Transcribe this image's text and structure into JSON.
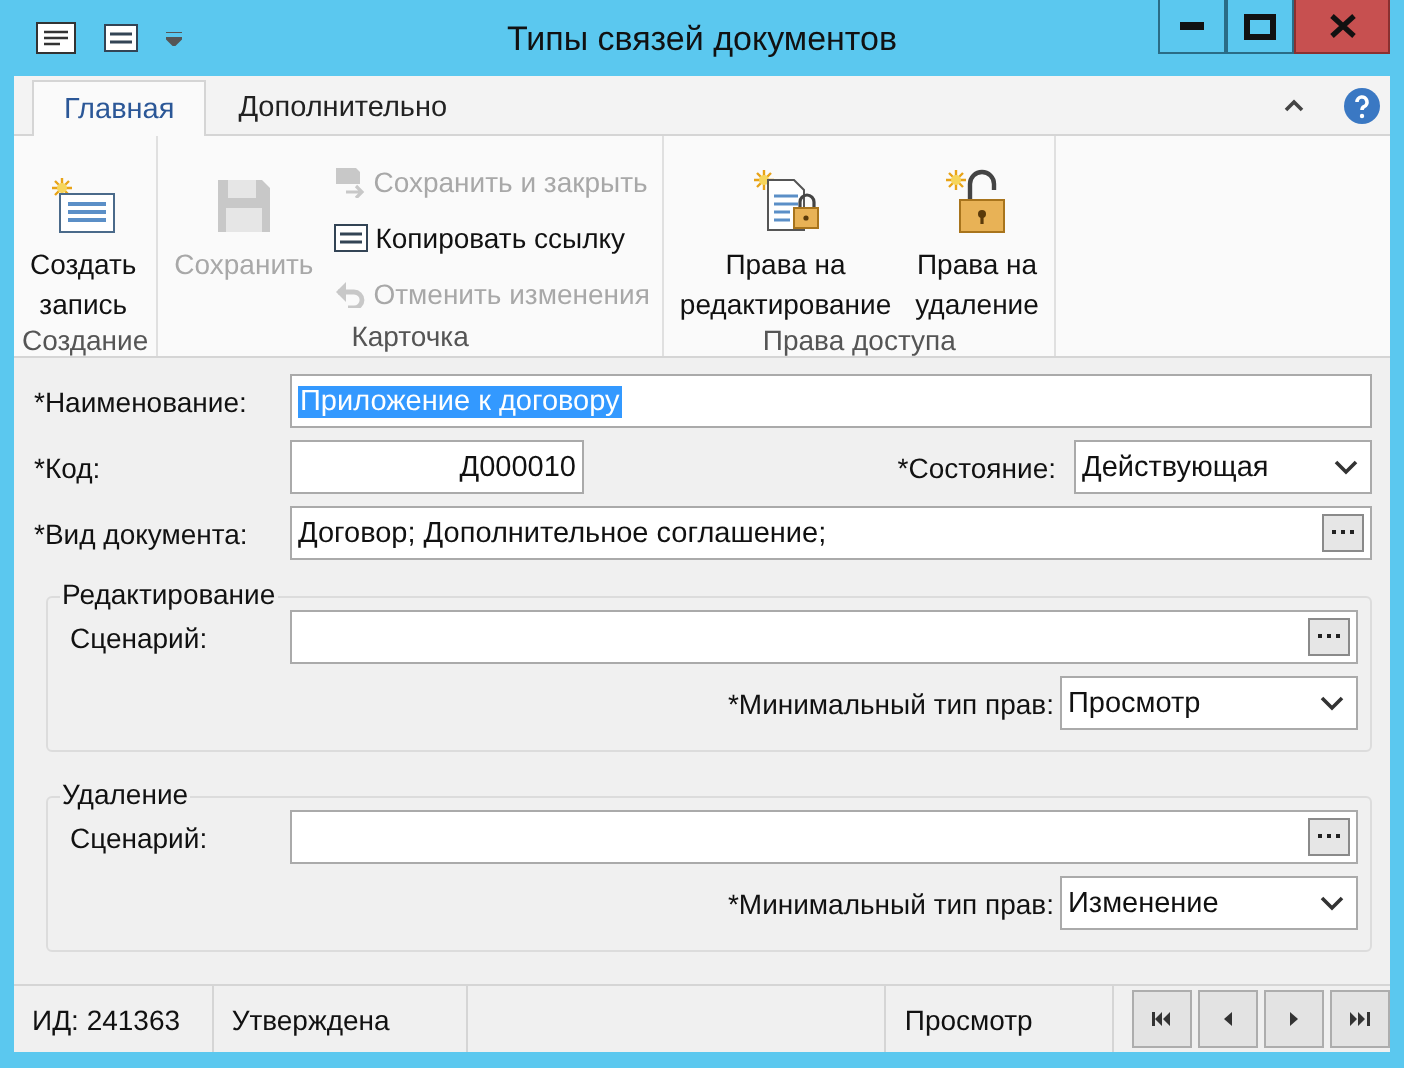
{
  "window": {
    "title": "Типы связей документов"
  },
  "ribbon": {
    "tabs": [
      {
        "label": "Главная",
        "selected": true
      },
      {
        "label": "Дополнительно",
        "selected": false
      }
    ],
    "groups": [
      {
        "label": "Создание",
        "items": [
          {
            "kind": "large",
            "lines": [
              "Создать",
              "запись"
            ],
            "disabled": false
          }
        ]
      },
      {
        "label": "Карточка",
        "items": [
          {
            "kind": "large",
            "lines": [
              "Сохранить"
            ],
            "disabled": true
          },
          {
            "kind": "small",
            "lines": [
              "Сохранить и закрыть"
            ],
            "disabled": true
          },
          {
            "kind": "small",
            "lines": [
              "Копировать ссылку"
            ],
            "disabled": false
          },
          {
            "kind": "small",
            "lines": [
              "Отменить изменения"
            ],
            "disabled": true
          }
        ]
      },
      {
        "label": "Права доступа",
        "items": [
          {
            "kind": "large",
            "lines": [
              "Права на",
              "редактирование"
            ],
            "disabled": false
          },
          {
            "kind": "large",
            "lines": [
              "Права на",
              "удаление"
            ],
            "disabled": false
          }
        ]
      }
    ]
  },
  "form": {
    "name": {
      "label": "*Наименование:",
      "value": "Приложение к договору",
      "selected": true
    },
    "code": {
      "label": "*Код:",
      "value": "Д000010"
    },
    "state": {
      "label": "*Состояние:",
      "value": "Действующая"
    },
    "doc_type": {
      "label": "*Вид документа:",
      "value": "Договор; Дополнительное соглашение;"
    },
    "sections": [
      {
        "title": "Редактирование",
        "scenario_label": "Сценарий:",
        "rights_label": "*Минимальный тип прав:",
        "rights_value": "Просмотр"
      },
      {
        "title": "Удаление",
        "scenario_label": "Сценарий:",
        "rights_label": "*Минимальный тип прав:",
        "rights_value": "Изменение"
      }
    ]
  },
  "status_bar": {
    "id": "ИД: 241363",
    "status": "Утверждена",
    "mode": "Просмотр"
  }
}
